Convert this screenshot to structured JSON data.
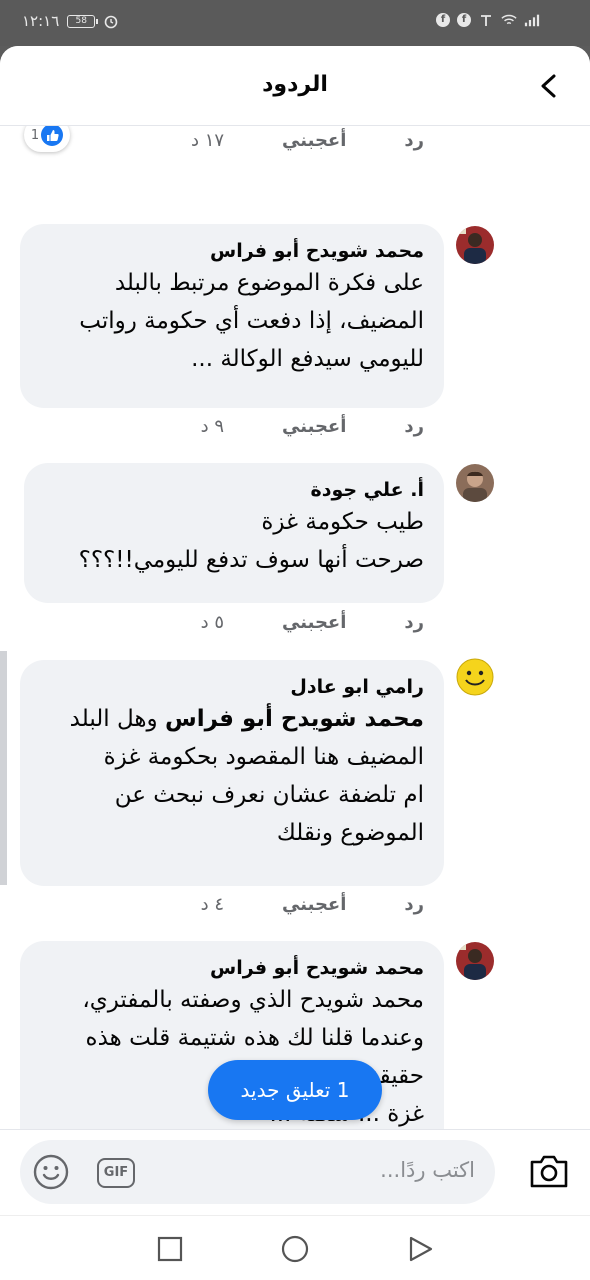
{
  "status_bar": {
    "time": "١٢:١٦"
  },
  "header": {
    "title": "الردود",
    "back_icon": "chevron-left-icon"
  },
  "top_reply_meta": {
    "time": "١٧ د",
    "like_label": "أعجبني",
    "reply_label": "رد",
    "reaction_count": "1"
  },
  "comments": [
    {
      "author": "محمد شويدح أبو فراس",
      "lines": [
        "على فكرة الموضوع مرتبط بالبلد",
        "المضيف، إذا دفعت أي حكومة رواتب",
        "لليومي سيدفع الوكالة ..."
      ],
      "time": "٩ د",
      "like_label": "أعجبني",
      "reply_label": "رد"
    },
    {
      "author": "أ. علي جودة",
      "lines": [
        "طيب حكومة غزة",
        "صرحت أنها سوف تدفع لليومي!!؟؟؟"
      ],
      "time": "٥ د",
      "like_label": "أعجبني",
      "reply_label": "رد"
    },
    {
      "author": "رامي ابو عادل",
      "mention": "محمد شويدح أبو فراس",
      "mention_rest": " وهل البلد",
      "lines": [
        "المضيف هنا المقصود بحكومة غزة",
        "ام تلضفة عشان نعرف نبحث عن",
        "الموضوع ونقلك"
      ],
      "time": "٤ د",
      "like_label": "أعجبني",
      "reply_label": "رد"
    },
    {
      "author": "محمد شويدح أبو فراس",
      "lines": [
        "محمد شويدح الذي وصفته بالمفتري،",
        "وعندما قلنا لك هذه شتيمة قلت هذه",
        "حقيقة !!",
        "غزة ... شكلة ..."
      ]
    }
  ],
  "new_comment_pill": {
    "label": "1 تعليق جديد"
  },
  "composer": {
    "placeholder": "اكتب ردًا...",
    "gif_label": "GIF"
  },
  "colors": {
    "accent": "#1877f2",
    "bubble": "#f0f2f5",
    "secondary_text": "#65676b"
  }
}
